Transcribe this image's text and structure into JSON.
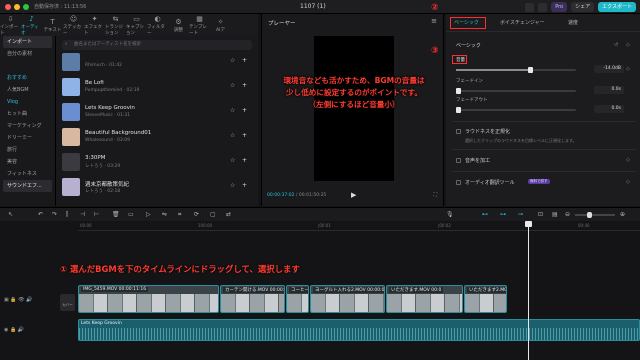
{
  "titlebar": {
    "autosave": "自動保存済 : 11:13:56",
    "title": "1107 (1)",
    "pro": "Pro",
    "share": "シェア",
    "export": "エクスポート"
  },
  "colors": {
    "accent": "#29c4d6",
    "annotation": "#ff3b30"
  },
  "toolbar": [
    {
      "label": "インポート",
      "icon": "import-icon"
    },
    {
      "label": "オーディオ",
      "icon": "audio-icon"
    },
    {
      "label": "テキスト",
      "icon": "text-icon"
    },
    {
      "label": "ステッカー",
      "icon": "sticker-icon"
    },
    {
      "label": "エフェクト",
      "icon": "effect-icon"
    },
    {
      "label": "トランジション",
      "icon": "transition-icon"
    },
    {
      "label": "キャプション",
      "icon": "caption-icon"
    },
    {
      "label": "フィルター",
      "icon": "filter-icon"
    },
    {
      "label": "調整",
      "icon": "adjust-icon"
    },
    {
      "label": "テンプレート",
      "icon": "template-icon"
    },
    {
      "label": "AIア",
      "icon": "ai-icon"
    }
  ],
  "leftnav": [
    "インポート",
    "自分の素材",
    "",
    "おすすめ",
    "人気BGM",
    "Vlog",
    "ヒット曲",
    "マーケティング",
    "ドリーミー",
    "旅行",
    "美容",
    "フィットネス",
    "サウンドエフ..."
  ],
  "musiclist": {
    "search_placeholder": "曲名またはアーティスト名を検索",
    "tracks": [
      {
        "name": "",
        "meta": "Rhimuch · 01:42"
      },
      {
        "name": "Be Lofi",
        "meta": "Pumpupthemind · 02:19"
      },
      {
        "name": "Lets Keep Groovin",
        "meta": "SleeveMusic · 01:31"
      },
      {
        "name": "Beautiful Background01",
        "meta": "Whalesound · 03:09"
      },
      {
        "name": "3:30PM",
        "meta": "レトろう · 03:29"
      },
      {
        "name": "週末京都散策気紀",
        "meta": "レトろう · 02:18"
      }
    ]
  },
  "player": {
    "title": "プレーヤー",
    "current": "00:00:37:02",
    "total": "00:01:50:25"
  },
  "overlay_text": "環境音なども活かすため、BGMの音量は\n少し低めに設定するのがポイントです。\n（左側にするほど音量小）",
  "rpanel": {
    "tabs": [
      "ベーシック",
      "ボイスチェンジャー",
      "速度"
    ],
    "basic": "ベーシック",
    "volume_label": "音量",
    "volume_value": "-14.0dB",
    "fadein_label": "フェードイン",
    "fadein_value": "0.0s",
    "fadeout_label": "フェードアウト",
    "fadeout_value": "0.0s",
    "normalize_label": "ラウドネスを正規化",
    "normalize_hint": "選択したクリップのラウドネスを目標レベルに正規化します。",
    "enhance_label": "音声を加工",
    "ai_translate_label": "オーディオ翻訳ツール",
    "ai_badge": "無料で試す",
    "circle2": "②",
    "circle3": "③",
    "volume_level_pct": 62
  },
  "timeline": {
    "ruler": [
      "00:00",
      "100:00",
      "|00:01",
      "|00:02",
      "00:40"
    ],
    "instruction": "① 選んだBGMを下のタイムラインにドラッグして、選択します",
    "cover_label": "カバー",
    "clips": [
      {
        "label": "IMG_5459.MOV  00:00:11:16"
      },
      {
        "label": "カーテン開ける.MOV  00:00:"
      },
      {
        "label": "コーヒー.MOV  00:0"
      },
      {
        "label": "ヨーグルト入れる2.MOV  00:00:06:1"
      },
      {
        "label": "いただきます.MOV  00:0"
      },
      {
        "label": "いただきます2.MOV  00:00:06:2"
      }
    ],
    "audio_label": "Lets Keep Groovin"
  }
}
